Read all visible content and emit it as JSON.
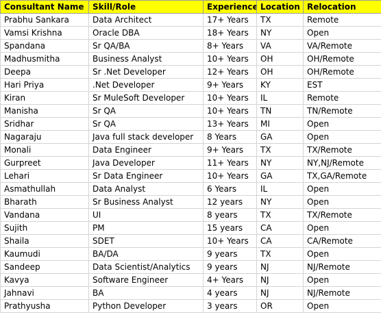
{
  "sheet": {
    "headers": {
      "name": "Consultant Name",
      "skill": "Skill/Role",
      "experience": "Experience",
      "location": "Location",
      "relocation": "Relocation"
    },
    "colors": {
      "header_fill": "#ffff00",
      "grid": "#d4d4d4"
    },
    "rows": [
      {
        "name": "Prabhu Sankara",
        "skill": "Data Architect",
        "experience": "17+ Years",
        "location": "TX",
        "relocation": "Remote"
      },
      {
        "name": "Vamsi Krishna",
        "skill": "Oracle DBA",
        "experience": "18+ Years",
        "location": "NY",
        "relocation": "Open"
      },
      {
        "name": "Spandana",
        "skill": "Sr QA/BA",
        "experience": "8+ Years",
        "location": "VA",
        "relocation": "VA/Remote"
      },
      {
        "name": "Madhusmitha",
        "skill": "Business Analyst",
        "experience": "10+ Years",
        "location": "OH",
        "relocation": "OH/Remote"
      },
      {
        "name": "Deepa",
        "skill": "Sr .Net Developer",
        "experience": "12+ Years",
        "location": "OH",
        "relocation": "OH/Remote"
      },
      {
        "name": "Hari Priya",
        "skill": ".Net Developer",
        "experience": "9+ Years",
        "location": "KY",
        "relocation": "EST"
      },
      {
        "name": "Kiran",
        "skill": "Sr MuleSoft Developer",
        "experience": "10+ Years",
        "location": "IL",
        "relocation": "Remote"
      },
      {
        "name": "Manisha",
        "skill": "Sr QA",
        "experience": "10+ Years",
        "location": "TN",
        "relocation": "TN/Remote"
      },
      {
        "name": "Sridhar",
        "skill": "Sr QA",
        "experience": "13+ Years",
        "location": "MI",
        "relocation": "Open"
      },
      {
        "name": "Nagaraju",
        "skill": "Java full stack developer",
        "experience": "8 Years",
        "location": "GA",
        "relocation": "Open"
      },
      {
        "name": "Monali",
        "skill": "Data Engineer",
        "experience": "9+ Years",
        "location": "TX",
        "relocation": "TX/Remote"
      },
      {
        "name": "Gurpreet",
        "skill": "Java Developer",
        "experience": "11+ Years",
        "location": "NY",
        "relocation": "NY,NJ/Remote"
      },
      {
        "name": "Lehari",
        "skill": "Sr Data Engineer",
        "experience": "10+ Years",
        "location": "GA",
        "relocation": "TX,GA/Remote"
      },
      {
        "name": "Asmathullah",
        "skill": "Data Analyst",
        "experience": "6 Years",
        "location": "IL",
        "relocation": "Open"
      },
      {
        "name": "Bharath",
        "skill": "Sr Business Analyst",
        "experience": "12 years",
        "location": "NY",
        "relocation": "Open"
      },
      {
        "name": "Vandana",
        "skill": "UI",
        "experience": "8 years",
        "location": "TX",
        "relocation": "TX/Remote"
      },
      {
        "name": "Sujith",
        "skill": "PM",
        "experience": "15 years",
        "location": "CA",
        "relocation": "Open"
      },
      {
        "name": "Shaila",
        "skill": "SDET",
        "experience": "10+ Years",
        "location": "CA",
        "relocation": "CA/Remote"
      },
      {
        "name": "Kaumudi",
        "skill": "BA/DA",
        "experience": "9 years",
        "location": "TX",
        "relocation": "Open"
      },
      {
        "name": "Sandeep",
        "skill": "Data Scientist/Analytics",
        "experience": "9 years",
        "location": "NJ",
        "relocation": "NJ/Remote"
      },
      {
        "name": "Kavya",
        "skill": "Software Engineer",
        "experience": "4+ Years",
        "location": "NJ",
        "relocation": "Open"
      },
      {
        "name": "Jahnavi",
        "skill": "BA",
        "experience": "4 years",
        "location": "NJ",
        "relocation": "NJ/Remote"
      },
      {
        "name": "Prathyusha",
        "skill": "Python Developer",
        "experience": "3 years",
        "location": "OR",
        "relocation": "Open"
      }
    ]
  }
}
